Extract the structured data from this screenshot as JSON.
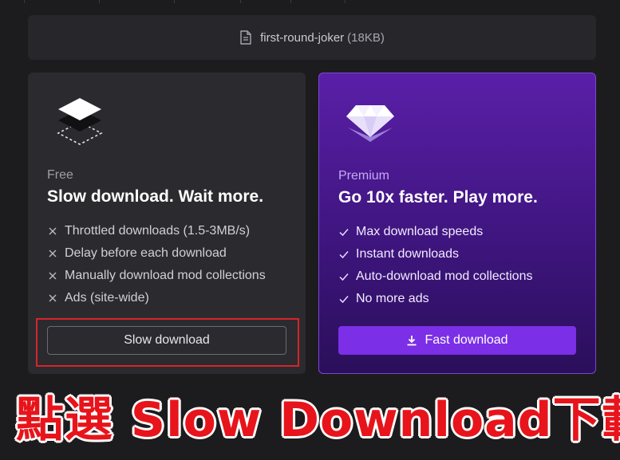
{
  "file": {
    "name": "first-round-joker",
    "size": "(18KB)",
    "icon": "file-icon"
  },
  "free": {
    "label": "Free",
    "title": "Slow download. Wait more.",
    "icon": "layers-icon",
    "features": [
      "Throttled downloads (1.5-3MB/s)",
      "Delay before each download",
      "Manually download mod collections",
      "Ads (site-wide)"
    ],
    "button_label": "Slow download"
  },
  "premium": {
    "label": "Premium",
    "title": "Go 10x faster. Play more.",
    "icon": "diamond-icon",
    "features": [
      "Max download speeds",
      "Instant downloads",
      "Auto-download mod collections",
      "No more ads"
    ],
    "button_label": "Fast download",
    "button_icon": "download-icon"
  },
  "caption": "點選 Slow Download下載",
  "colors": {
    "background": "#1c1c1f",
    "card": "#2b2b2f",
    "premium_accent": "#7b2fe6",
    "highlight": "#d8232a"
  }
}
